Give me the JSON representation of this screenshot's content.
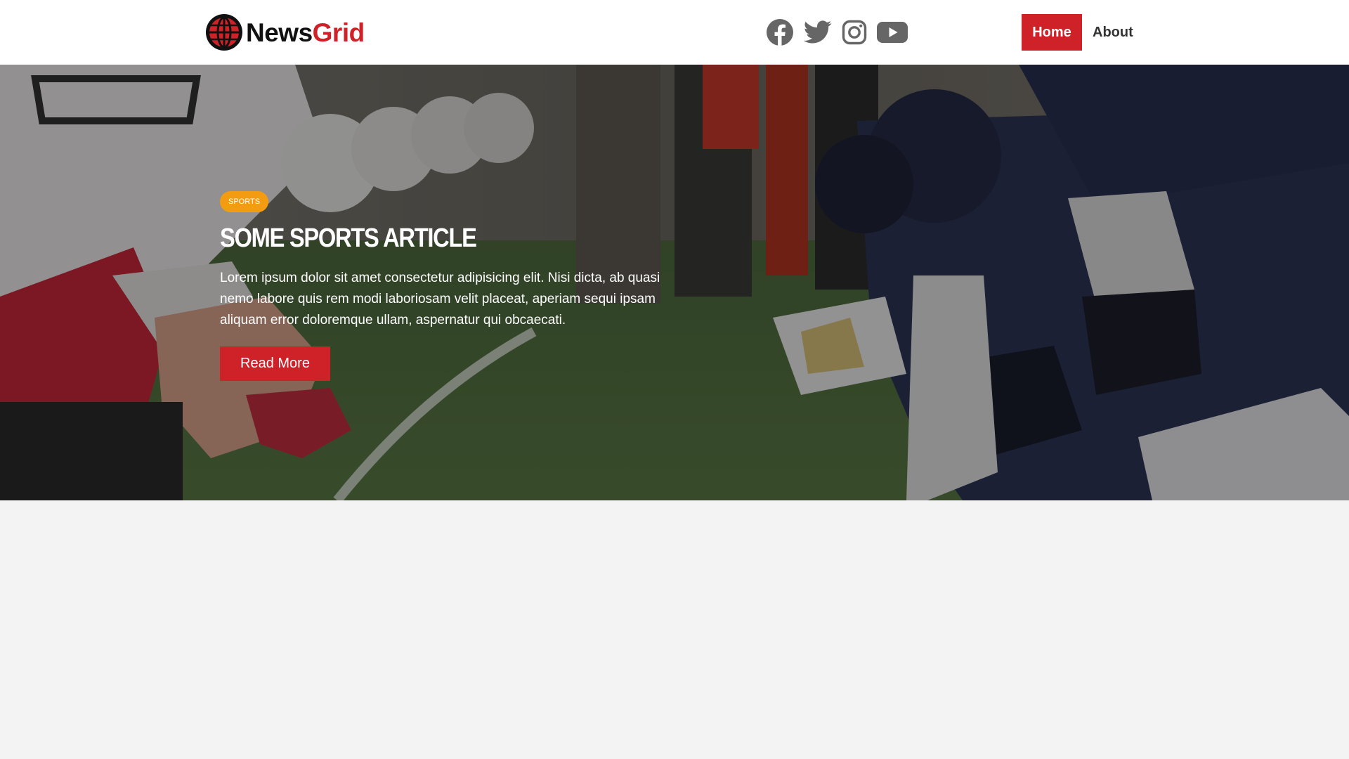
{
  "header": {
    "logo": {
      "news": "News",
      "grid": "Grid",
      "icon": "globe-icon"
    },
    "social": [
      {
        "name": "facebook",
        "icon": "facebook-icon"
      },
      {
        "name": "twitter",
        "icon": "twitter-icon"
      },
      {
        "name": "instagram",
        "icon": "instagram-icon"
      },
      {
        "name": "youtube",
        "icon": "youtube-icon"
      }
    ],
    "nav": [
      {
        "label": "Home",
        "active": true
      },
      {
        "label": "About",
        "active": false
      }
    ]
  },
  "hero": {
    "badge": "Sports",
    "title": "Some Sports Article",
    "text": "Lorem ipsum dolor sit amet consectetur adipisicing elit. Nisi dicta, ab quasi nemo labore quis rem modi laboriosam velit placeat, aperiam sequi ipsam aliquam error doloremque ullam, aspernatur qui obcaecati.",
    "button": "Read More",
    "background": "football-line-of-scrimmage-photo"
  },
  "colors": {
    "brand_red": "#cf2228",
    "badge_orange": "#f39c12",
    "icon_gray": "#666666",
    "page_bg": "#f3f3f3"
  }
}
